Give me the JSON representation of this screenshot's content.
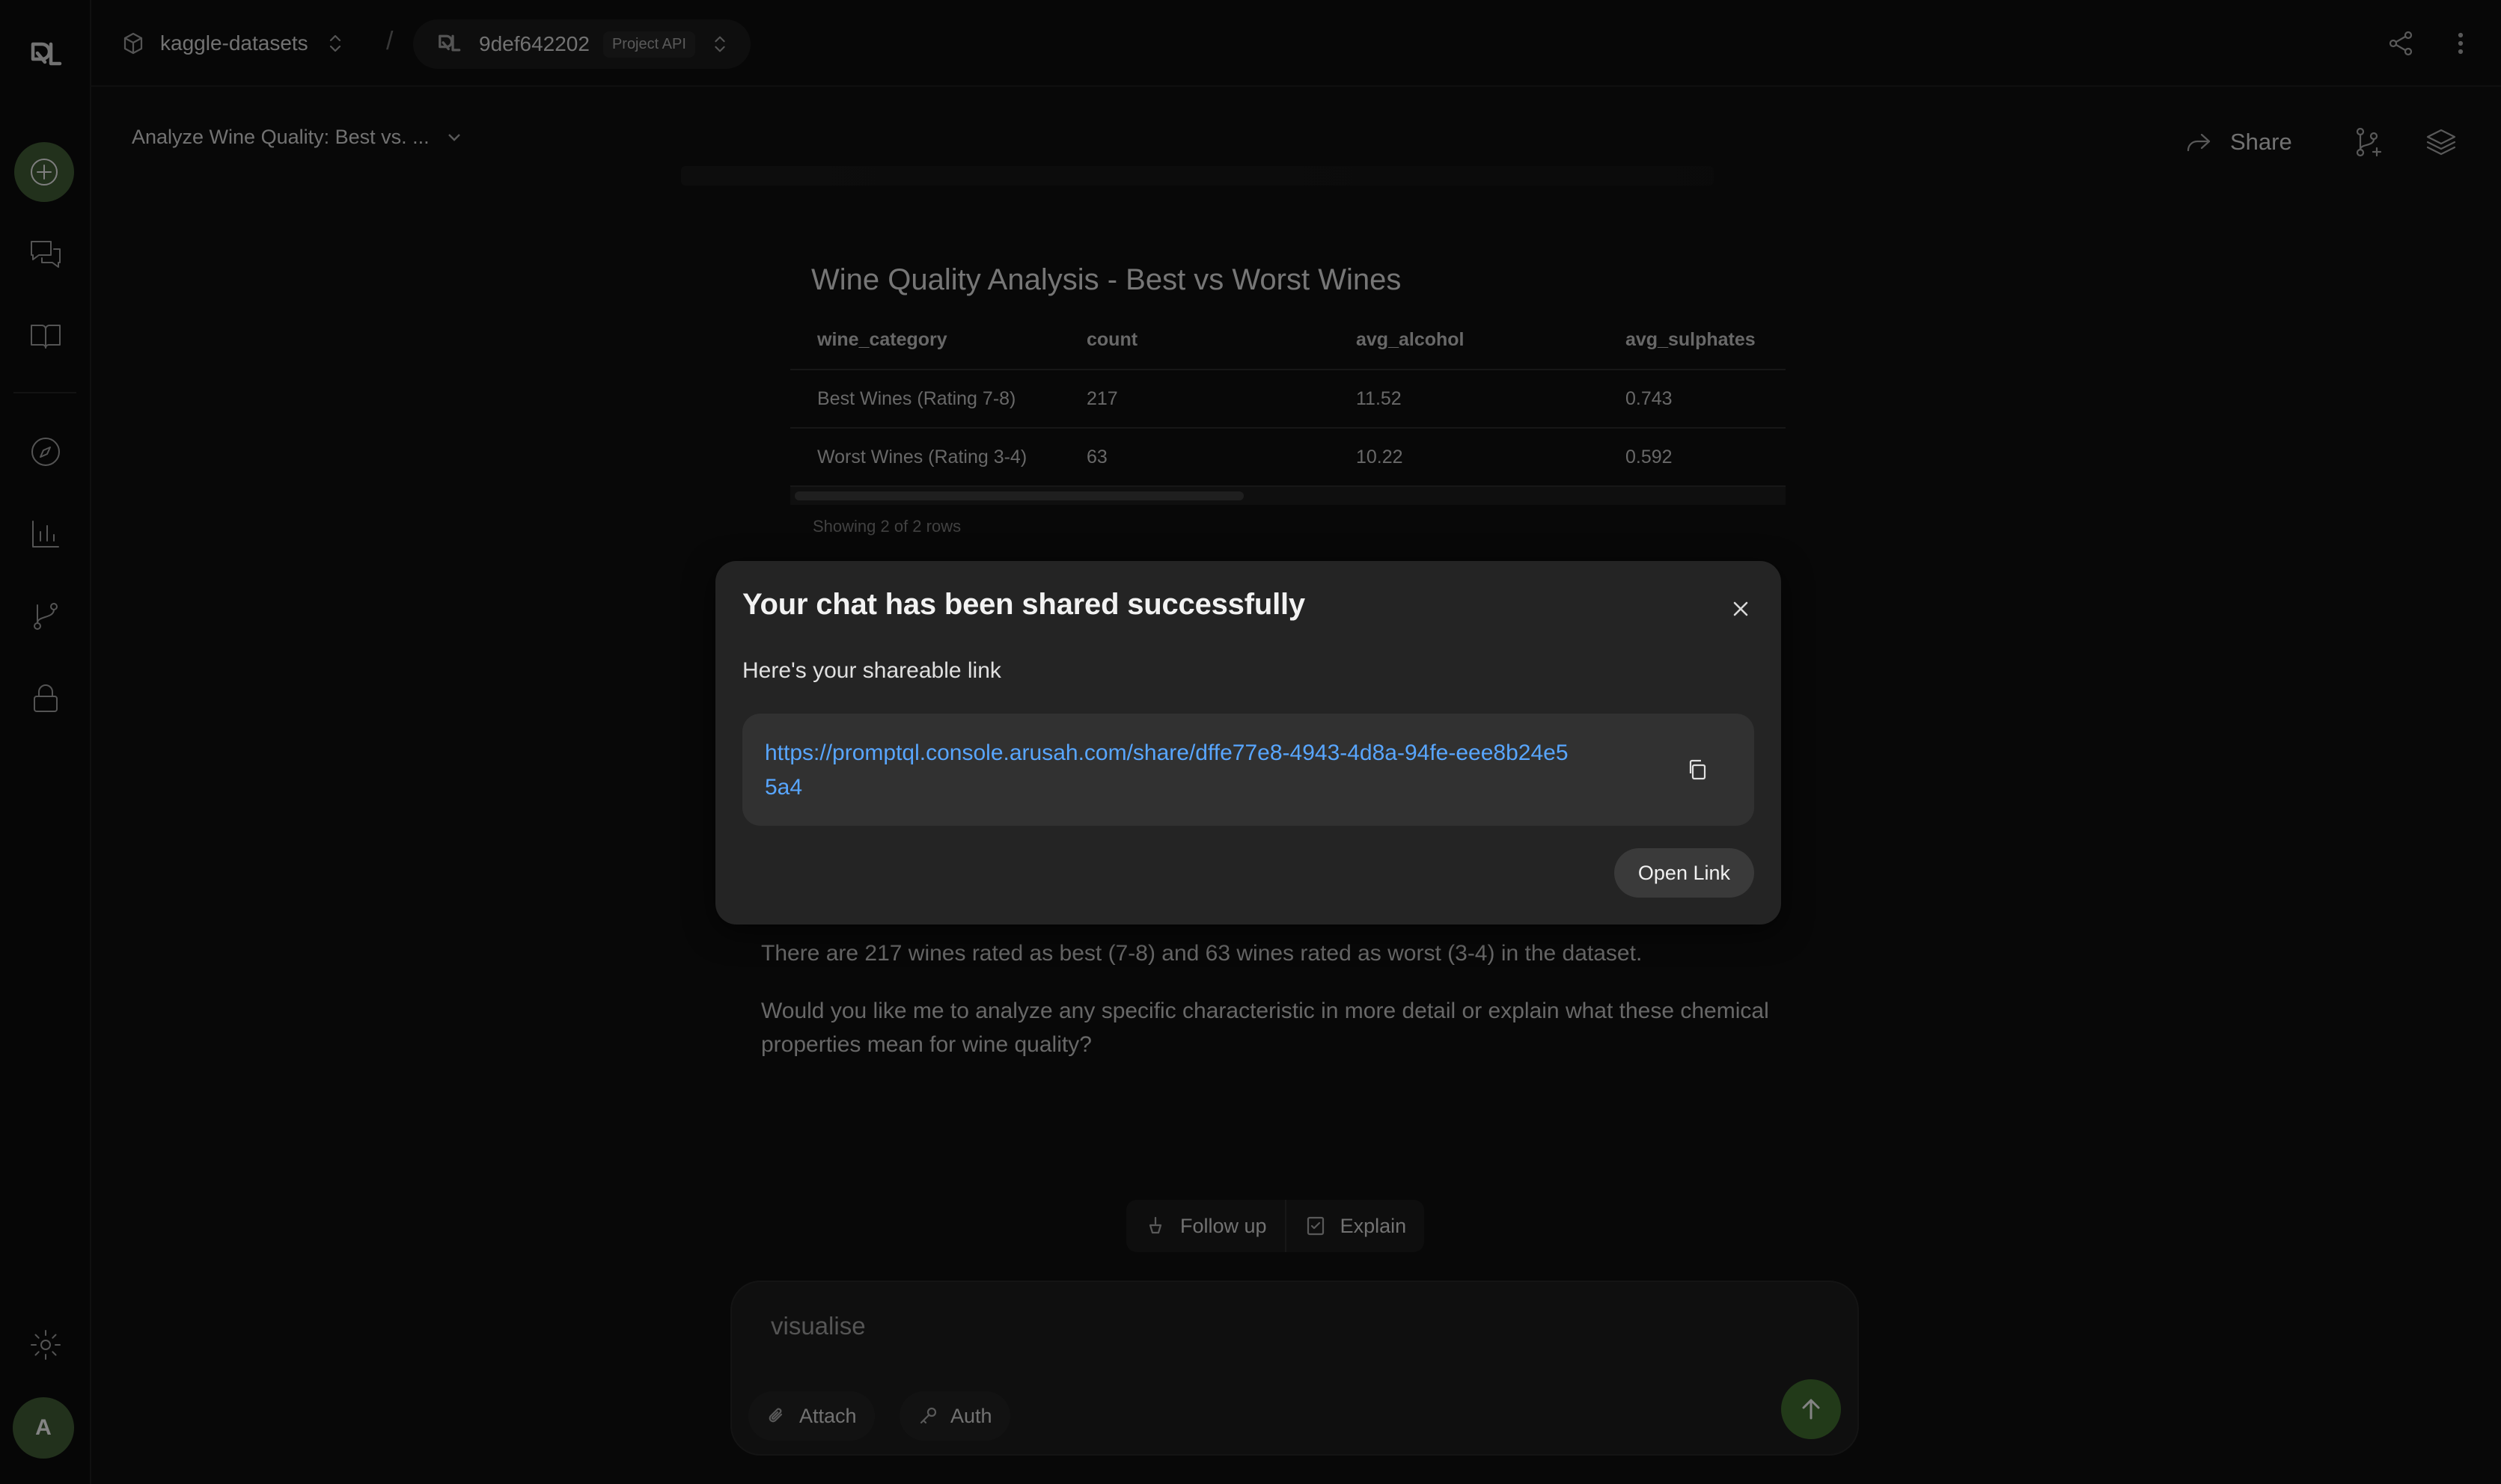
{
  "topbar": {
    "project_name": "kaggle-datasets",
    "separator": "/",
    "build_hash": "9def642202",
    "build_tag": "Project API"
  },
  "thread": {
    "title": "Analyze Wine Quality: Best vs. ...",
    "share_label": "Share"
  },
  "table": {
    "title": "Wine Quality Analysis - Best vs Worst Wines",
    "columns": [
      "wine_category",
      "count",
      "avg_alcohol",
      "avg_sulphates"
    ],
    "rows": [
      [
        "Best Wines (Rating 7-8)",
        "217",
        "11.52",
        "0.743"
      ],
      [
        "Worst Wines (Rating 3-4)",
        "63",
        "10.22",
        "0.592"
      ]
    ],
    "footer": "Showing 2 of 2 rows"
  },
  "answer": {
    "p1": "There are 217 wines rated as best (7-8) and 63 wines rated as worst (3-4) in the dataset.",
    "p2": "Would you like me to analyze any specific characteristic in more detail or explain what these chemical properties mean for wine quality?"
  },
  "quick_actions": {
    "follow_up": "Follow up",
    "explain": "Explain"
  },
  "composer": {
    "value": "visualise",
    "attach_label": "Attach",
    "auth_label": "Auth"
  },
  "rail": {
    "avatar_initial": "A",
    "accent_color": "#3f5a34"
  },
  "modal": {
    "title": "Your chat has been shared successfully",
    "subtitle": "Here's your shareable link",
    "link": "https://promptql.console.arusah.com/share/dffe77e8-4943-4d8a-94fe-eee8b24e55a4",
    "open_link_label": "Open Link",
    "link_color": "#58a6ff"
  },
  "icons": {
    "logo": "promptql-logo-icon",
    "new_chat": "plus-circle-icon",
    "threads": "chat-bubbles-icon",
    "library": "book-icon",
    "explore": "compass-icon",
    "analytics": "bar-chart-icon",
    "branches": "git-branch-icon",
    "security": "lock-icon",
    "settings": "gear-icon"
  }
}
